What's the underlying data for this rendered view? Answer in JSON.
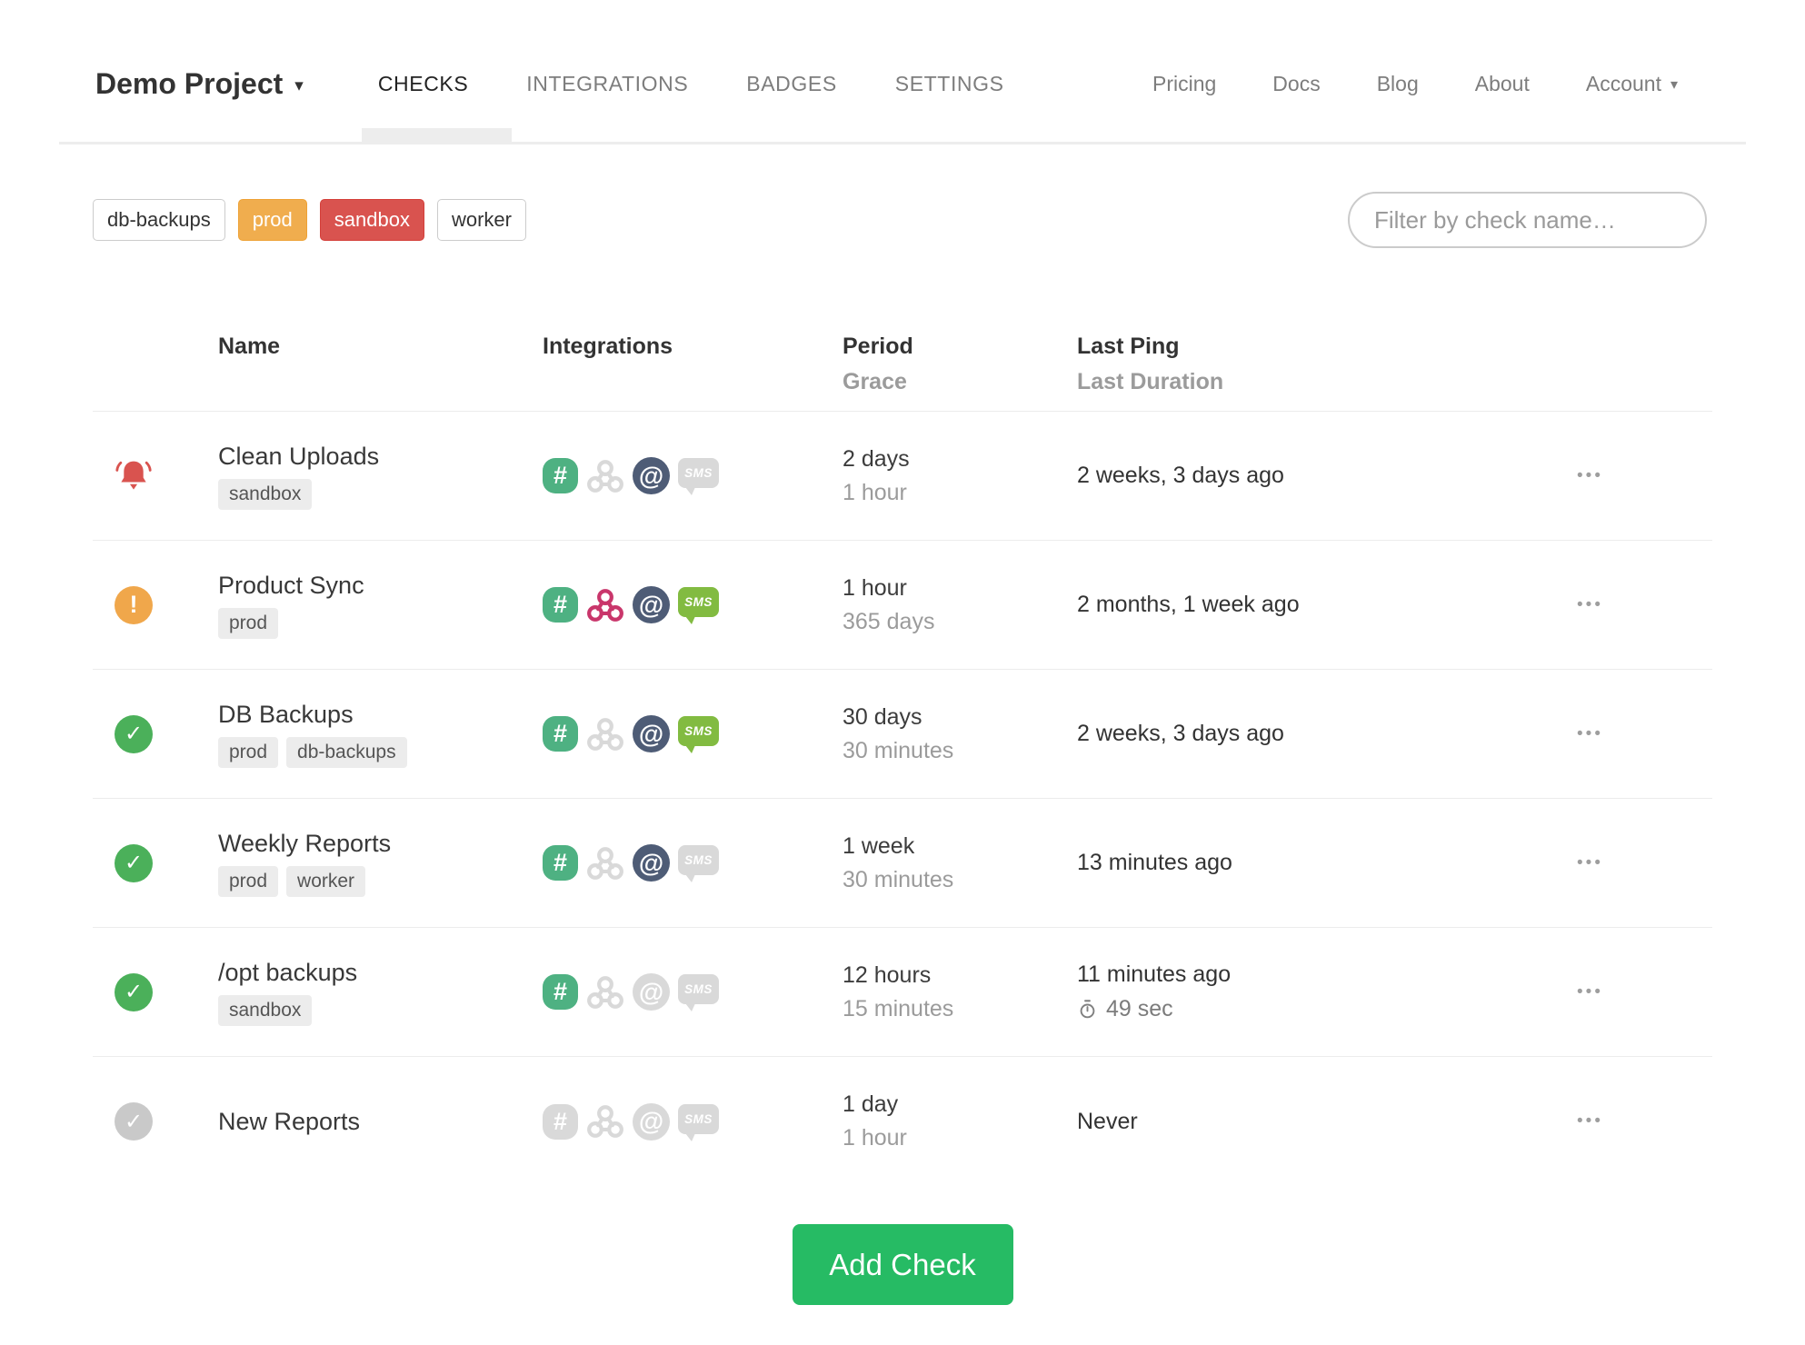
{
  "icons": {
    "project_caret": "▾",
    "account_caret": "▾",
    "slack": "#",
    "email": "@",
    "sms": "SMS",
    "more": "•••",
    "status_up": "✓",
    "status_new": "✓",
    "status_late": "!"
  },
  "colors": {
    "accent_green": "#26bb64",
    "danger_red": "#d9534f",
    "warning_orange": "#f0ad4e",
    "slack_green": "#4eb182",
    "webhook_crimson": "#c9366b",
    "email_slate": "#4e5c76",
    "sms_green": "#82bb41",
    "inactive_gray": "#d9d9d9"
  },
  "nav": {
    "project_label": "Demo Project",
    "tabs": [
      {
        "label": "CHECKS",
        "active": true
      },
      {
        "label": "INTEGRATIONS",
        "active": false
      },
      {
        "label": "BADGES",
        "active": false
      },
      {
        "label": "SETTINGS",
        "active": false
      }
    ],
    "links": [
      {
        "label": "Pricing"
      },
      {
        "label": "Docs"
      },
      {
        "label": "Blog"
      },
      {
        "label": "About"
      }
    ],
    "account_label": "Account"
  },
  "toolbar": {
    "tags": [
      {
        "label": "db-backups",
        "style": "outline"
      },
      {
        "label": "prod",
        "style": "warning"
      },
      {
        "label": "sandbox",
        "style": "danger"
      },
      {
        "label": "worker",
        "style": "outline"
      }
    ],
    "search_placeholder": "Filter by check name…"
  },
  "table": {
    "headers": {
      "name": "Name",
      "integrations": "Integrations",
      "period": "Period",
      "grace": "Grace",
      "last_ping": "Last Ping",
      "last_duration": "Last Duration"
    },
    "rows": [
      {
        "status": "alert",
        "name": "Clean Uploads",
        "tags": [
          "sandbox"
        ],
        "integrations": {
          "slack": true,
          "webhook": false,
          "email": true,
          "sms": false
        },
        "period": "2 days",
        "grace": "1 hour",
        "last_ping": "2 weeks, 3 days ago"
      },
      {
        "status": "late",
        "name": "Product Sync",
        "tags": [
          "prod"
        ],
        "integrations": {
          "slack": true,
          "webhook": true,
          "email": true,
          "sms": true
        },
        "period": "1 hour",
        "grace": "365 days",
        "last_ping": "2 months, 1 week ago"
      },
      {
        "status": "up",
        "name": "DB Backups",
        "tags": [
          "prod",
          "db-backups"
        ],
        "integrations": {
          "slack": true,
          "webhook": false,
          "email": true,
          "sms": true
        },
        "period": "30 days",
        "grace": "30 minutes",
        "last_ping": "2 weeks, 3 days ago"
      },
      {
        "status": "up",
        "name": "Weekly Reports",
        "tags": [
          "prod",
          "worker"
        ],
        "integrations": {
          "slack": true,
          "webhook": false,
          "email": true,
          "sms": false
        },
        "period": "1 week",
        "grace": "30 minutes",
        "last_ping": "13 minutes ago"
      },
      {
        "status": "up",
        "name": "/opt backups",
        "tags": [
          "sandbox"
        ],
        "integrations": {
          "slack": true,
          "webhook": false,
          "email": false,
          "sms": false
        },
        "period": "12 hours",
        "grace": "15 minutes",
        "last_ping": "11 minutes ago",
        "last_duration": "49 sec"
      },
      {
        "status": "new",
        "name": "New Reports",
        "tags": [],
        "integrations": {
          "slack": false,
          "webhook": false,
          "email": false,
          "sms": false
        },
        "period": "1 day",
        "grace": "1 hour",
        "last_ping": "Never"
      }
    ]
  },
  "footer": {
    "add_check_label": "Add Check"
  }
}
